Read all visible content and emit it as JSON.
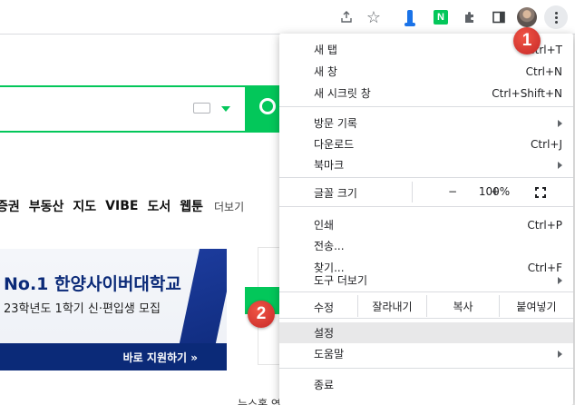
{
  "toolbar": {
    "extensions": [
      "share-icon",
      "star-icon",
      "blue-extension-icon",
      "naver-extension-icon",
      "puzzle-icon",
      "side-panel-icon",
      "avatar",
      "more-vert-icon"
    ],
    "naver_badge_letter": "N"
  },
  "page": {
    "nav_items": [
      "증권",
      "부동산",
      "지도",
      "VIBE",
      "도서",
      "웹툰"
    ],
    "nav_more": "더보기",
    "banner": {
      "title": "No.1 한양사이버대학교",
      "subtitle": "23학년도 1학기 신·편입생 모집",
      "apply": "바로 지원하기 »"
    },
    "bottom_row": "뉴스홈  연예  스포츠  경제"
  },
  "menu": {
    "new_tab": "새 탭",
    "new_tab_shortcut": "Ctrl+T",
    "new_window": "새 창",
    "new_window_shortcut": "Ctrl+N",
    "incognito": "새 시크릿 창",
    "incognito_shortcut": "Ctrl+Shift+N",
    "history": "방문 기록",
    "downloads": "다운로드",
    "downloads_shortcut": "Ctrl+J",
    "bookmarks": "북마크",
    "zoom_label": "글꼴 크기",
    "zoom_minus": "−",
    "zoom_value": "100%",
    "zoom_plus": "+",
    "print": "인쇄",
    "print_shortcut": "Ctrl+P",
    "cast": "전송...",
    "find": "찾기...",
    "find_shortcut": "Ctrl+F",
    "more_tools": "도구 더보기",
    "edit_label": "수정",
    "cut": "잘라내기",
    "copy": "복사",
    "paste": "붙여넣기",
    "settings": "설정",
    "help": "도움말",
    "exit": "종료"
  },
  "annotations": {
    "badge_1": "1",
    "badge_2": "2"
  }
}
